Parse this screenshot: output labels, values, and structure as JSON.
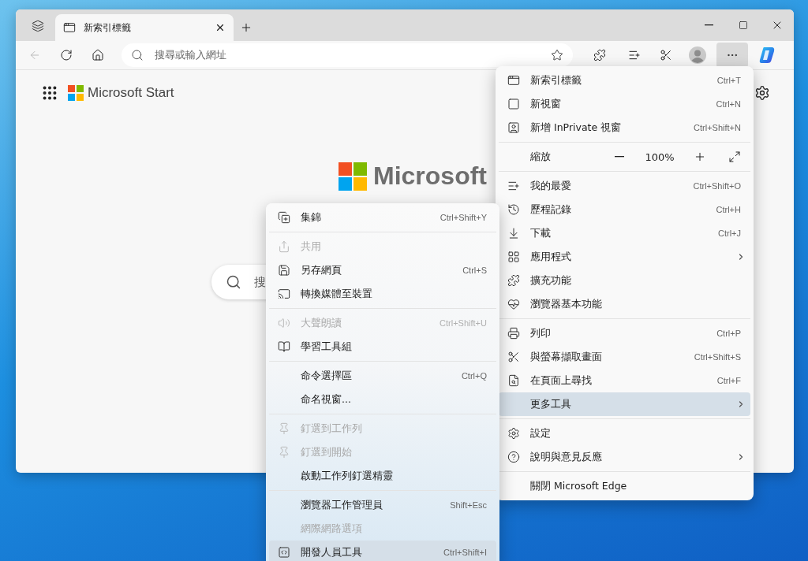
{
  "tab": {
    "title": "新索引標籤",
    "selected": true
  },
  "address_bar": {
    "placeholder": "搜尋或輸入網址"
  },
  "page": {
    "brand": "Microsoft Start",
    "hero_logo": "Microsoft",
    "search": {
      "placeholder": "搜"
    }
  },
  "main_menu": {
    "groups": [
      [
        {
          "kind": "item",
          "label": "新索引標籤",
          "shortcut": "Ctrl+T",
          "submenu": false,
          "selected": false
        },
        {
          "kind": "item",
          "label": "新視窗",
          "shortcut": "Ctrl+N",
          "submenu": false,
          "selected": false
        },
        {
          "kind": "item",
          "label": "新增 InPrivate 視窗",
          "shortcut": "Ctrl+Shift+N",
          "submenu": false,
          "selected": false
        }
      ],
      [
        {
          "kind": "zoom",
          "label": "縮放",
          "value": "100%"
        }
      ],
      [
        {
          "kind": "item",
          "label": "我的最愛",
          "shortcut": "Ctrl+Shift+O",
          "submenu": false,
          "selected": false
        },
        {
          "kind": "item",
          "label": "歷程記錄",
          "shortcut": "Ctrl+H",
          "submenu": false,
          "selected": false
        },
        {
          "kind": "item",
          "label": "下載",
          "shortcut": "Ctrl+J",
          "submenu": false,
          "selected": false
        },
        {
          "kind": "item",
          "label": "應用程式",
          "submenu": true,
          "selected": false
        },
        {
          "kind": "item",
          "label": "擴充功能",
          "submenu": false,
          "selected": false
        },
        {
          "kind": "item",
          "label": "瀏覽器基本功能",
          "submenu": false,
          "selected": false
        }
      ],
      [
        {
          "kind": "item",
          "label": "列印",
          "shortcut": "Ctrl+P",
          "submenu": false,
          "selected": false
        },
        {
          "kind": "item",
          "label": "與螢幕擷取畫面",
          "shortcut": "Ctrl+Shift+S",
          "submenu": false,
          "selected": false
        },
        {
          "kind": "item",
          "label": "在頁面上尋找",
          "shortcut": "Ctrl+F",
          "submenu": false,
          "selected": false
        },
        {
          "kind": "item",
          "label": "更多工具",
          "submenu": true,
          "selected": true
        }
      ],
      [
        {
          "kind": "item",
          "label": "設定",
          "submenu": false,
          "selected": false
        },
        {
          "kind": "item",
          "label": "說明與意見反應",
          "submenu": true,
          "selected": false
        }
      ],
      [
        {
          "kind": "item",
          "label": "關閉 Microsoft Edge",
          "submenu": false,
          "selected": false
        }
      ]
    ]
  },
  "more_tools_menu": {
    "groups": [
      [
        {
          "label": "集錦",
          "shortcut": "Ctrl+Shift+Y",
          "disabled": false,
          "selected": false
        }
      ],
      [
        {
          "label": "共用",
          "disabled": true,
          "selected": false
        },
        {
          "label": "另存網頁",
          "shortcut": "Ctrl+S",
          "disabled": false,
          "selected": false
        },
        {
          "label": "轉換媒體至裝置",
          "disabled": false,
          "selected": false
        }
      ],
      [
        {
          "label": "大聲朗讀",
          "shortcut": "Ctrl+Shift+U",
          "disabled": true,
          "selected": false
        },
        {
          "label": "學習工具組",
          "disabled": false,
          "selected": false
        }
      ],
      [
        {
          "label": "命令選擇區",
          "shortcut": "Ctrl+Q",
          "disabled": false,
          "selected": false
        },
        {
          "label": "命名視窗...",
          "disabled": false,
          "selected": false
        }
      ],
      [
        {
          "label": "釘選到工作列",
          "disabled": true,
          "selected": false
        },
        {
          "label": "釘選到開始",
          "disabled": true,
          "selected": false
        },
        {
          "label": "啟動工作列釘選精靈",
          "disabled": false,
          "selected": false
        }
      ],
      [
        {
          "label": "瀏覽器工作管理員",
          "shortcut": "Shift+Esc",
          "disabled": false,
          "selected": false
        },
        {
          "label": "網際網路選項",
          "disabled": true,
          "selected": false
        },
        {
          "label": "開發人員工具",
          "shortcut": "Ctrl+Shift+I",
          "disabled": false,
          "selected": true
        }
      ]
    ]
  }
}
